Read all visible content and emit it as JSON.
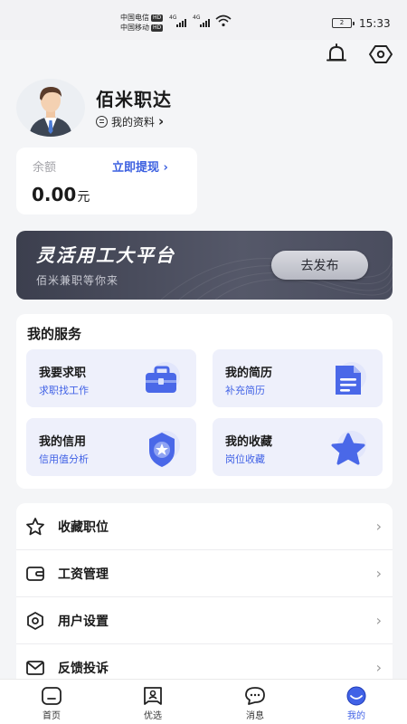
{
  "status_bar": {
    "carrier1": "中国电信",
    "carrier2": "中国移动",
    "hd": "HD",
    "net": "4G",
    "battery": "2",
    "time": "15:33"
  },
  "header_icons": [
    "bell-icon",
    "settings-icon"
  ],
  "profile": {
    "name": "佰米职达",
    "link_label": "我的资料",
    "link_arrow": "›"
  },
  "balance": {
    "label": "余额",
    "withdraw_label": "立即提现",
    "withdraw_arrow": "›",
    "amount": "0.00",
    "unit": "元"
  },
  "banner": {
    "title": "灵活用工大平台",
    "subtitle": "佰米兼职等你来",
    "button_label": "去发布"
  },
  "services": {
    "title": "我的服务",
    "items": [
      {
        "name": "我要求职",
        "desc": "求职找工作",
        "icon": "briefcase-icon"
      },
      {
        "name": "我的简历",
        "desc": "补充简历",
        "icon": "resume-icon"
      },
      {
        "name": "我的信用",
        "desc": "信用值分析",
        "icon": "badge-icon"
      },
      {
        "name": "我的收藏",
        "desc": "岗位收藏",
        "icon": "star-icon"
      }
    ]
  },
  "menu": {
    "items": [
      {
        "label": "收藏职位",
        "icon": "star-outline-icon"
      },
      {
        "label": "工资管理",
        "icon": "wallet-icon"
      },
      {
        "label": "用户设置",
        "icon": "settings-icon"
      },
      {
        "label": "反馈投诉",
        "icon": "mail-icon"
      }
    ],
    "arrow": "›"
  },
  "tabbar": {
    "items": [
      {
        "label": "首页",
        "icon": "home-icon",
        "active": false
      },
      {
        "label": "优选",
        "icon": "picks-icon",
        "active": false
      },
      {
        "label": "消息",
        "icon": "message-icon",
        "active": false
      },
      {
        "label": "我的",
        "icon": "profile-icon",
        "active": true
      }
    ]
  },
  "colors": {
    "accent": "#4162e6",
    "banner_bg": "#484b5b",
    "card_bg": "#eef0fb"
  }
}
